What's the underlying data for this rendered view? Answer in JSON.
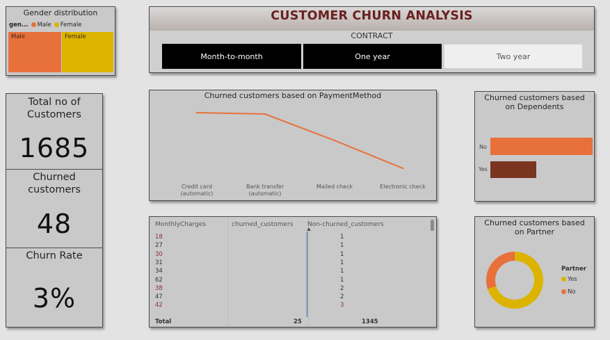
{
  "colors": {
    "orange": "#e8703a",
    "gold": "#dcb400",
    "brown": "#7a3520",
    "title_red": "#6b2020"
  },
  "gender": {
    "title": "Gender distribution",
    "legend_title": "gen...",
    "legend": [
      {
        "label": "Male",
        "color": "#e8703a"
      },
      {
        "label": "Female",
        "color": "#dcb400"
      }
    ],
    "tiles": [
      "Male",
      "Female"
    ]
  },
  "header": {
    "title": "CUSTOMER CHURN ANALYSIS",
    "contract_label": "CONTRACT",
    "options": [
      "Month-to-month",
      "One year",
      "Two year"
    ]
  },
  "kpis": [
    {
      "label": "Total no of Customers",
      "value": "1685"
    },
    {
      "label": "Churned customers",
      "value": "48"
    },
    {
      "label": "Churn Rate",
      "value": "3%"
    }
  ],
  "payment_chart": {
    "title": "Churned customers based on PaymentMethod",
    "categories": [
      "Credit card (automatic)",
      "Bank transfer (automatic)",
      "Mailed check",
      "Electronic check"
    ]
  },
  "dependents": {
    "title": "Churned customers based on Dependents",
    "labels": [
      "No",
      "Yes"
    ]
  },
  "table": {
    "headers": [
      "MonthlyCharges",
      "churned_customers",
      "Non-churned_customers"
    ],
    "rows": [
      {
        "charge": "18",
        "non": "1"
      },
      {
        "charge": "27",
        "non": "1"
      },
      {
        "charge": "30",
        "non": "1"
      },
      {
        "charge": "31",
        "non": "1"
      },
      {
        "charge": "34",
        "non": "1"
      },
      {
        "charge": "62",
        "non": "1"
      },
      {
        "charge": "38",
        "non": "2"
      },
      {
        "charge": "47",
        "non": "2"
      },
      {
        "charge": "42",
        "non": "3"
      }
    ],
    "total_label": "Total",
    "total_churned": "25",
    "total_non": "1345"
  },
  "partner": {
    "title": "Churned customers based on Partner",
    "legend_title": "Partner",
    "legend": [
      {
        "label": "Yes",
        "color": "#dcb400"
      },
      {
        "label": "No",
        "color": "#e8703a"
      }
    ]
  },
  "chart_data": [
    {
      "type": "line",
      "title": "Churned customers based on PaymentMethod",
      "categories": [
        "Credit card (automatic)",
        "Bank transfer (automatic)",
        "Mailed check",
        "Electronic check"
      ],
      "series": [
        {
          "values": [
            22,
            21.5,
            12,
            2
          ]
        }
      ],
      "ylim": [
        0,
        25
      ],
      "grid": false
    },
    {
      "type": "bar",
      "title": "Churned customers based on Dependents",
      "orientation": "horizontal",
      "categories": [
        "No",
        "Yes"
      ],
      "values": [
        40,
        18
      ],
      "xlim": [
        0,
        40
      ],
      "colors": [
        "#e8703a",
        "#7a3520"
      ]
    },
    {
      "type": "pie",
      "style": "donut",
      "title": "Churned customers based on Partner",
      "categories": [
        "Yes",
        "No"
      ],
      "values": [
        70,
        30
      ],
      "colors": [
        "#dcb400",
        "#e8703a"
      ],
      "legend": "right"
    },
    {
      "type": "bar",
      "title": "Gender distribution",
      "subtype": "treemap",
      "categories": [
        "Male",
        "Female"
      ],
      "values": [
        50,
        50
      ],
      "colors": [
        "#e8703a",
        "#dcb400"
      ]
    }
  ]
}
